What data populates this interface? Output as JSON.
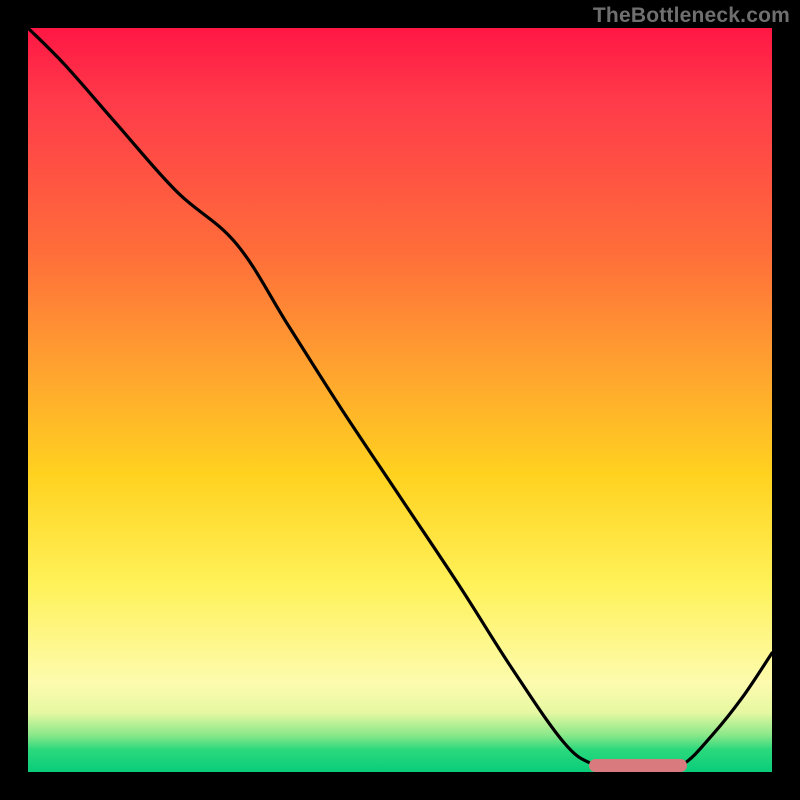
{
  "attribution": "TheBottleneck.com",
  "colors": {
    "frame": "#000000",
    "curve": "#000000",
    "marker": "#d97a7f",
    "gradient_top": "#ff1744",
    "gradient_bottom": "#09cc7a"
  },
  "chart_data": {
    "type": "line",
    "title": "",
    "xlabel": "",
    "ylabel": "",
    "xlim": [
      0,
      100
    ],
    "ylim": [
      0,
      100
    ],
    "x": [
      0,
      5,
      12,
      20,
      28,
      35,
      42,
      50,
      58,
      65,
      72,
      76,
      80,
      84,
      88,
      92,
      96,
      100
    ],
    "values": [
      100,
      95,
      87,
      78,
      71,
      60,
      49,
      37,
      25,
      14,
      4,
      1,
      0,
      0,
      1,
      5,
      10,
      16
    ],
    "flat_region": {
      "x_start": 76,
      "x_end": 88,
      "y": 0
    },
    "gradient_stops": [
      {
        "pos": 0,
        "color": "#ff1744"
      },
      {
        "pos": 10,
        "color": "#ff3b4a"
      },
      {
        "pos": 30,
        "color": "#ff6d3a"
      },
      {
        "pos": 45,
        "color": "#ffa030"
      },
      {
        "pos": 60,
        "color": "#ffd21f"
      },
      {
        "pos": 75,
        "color": "#fff25a"
      },
      {
        "pos": 88,
        "color": "#fdfbae"
      },
      {
        "pos": 92,
        "color": "#e6f8a2"
      },
      {
        "pos": 95,
        "color": "#8be88a"
      },
      {
        "pos": 97,
        "color": "#2bd97c"
      },
      {
        "pos": 100,
        "color": "#09cc7a"
      }
    ]
  }
}
